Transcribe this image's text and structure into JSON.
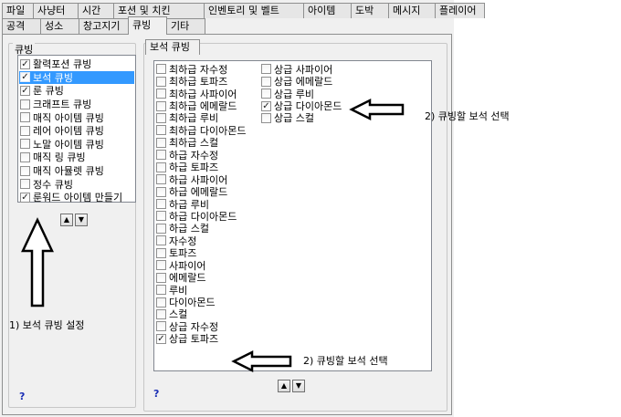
{
  "tabs_row1": [
    "파일",
    "사냥터",
    "시간",
    "포션 및 치킨",
    "인벤토리 및 벨트",
    "아이템",
    "도박",
    "메시지",
    "플레이어"
  ],
  "tabs_row2": [
    "공격",
    "성소",
    "창고지기",
    "큐빙",
    "기타"
  ],
  "active_tab": "큐빙",
  "left_panel": {
    "title": "큐빙",
    "items": [
      {
        "label": "활력포션 큐빙",
        "checked": true,
        "selected": false
      },
      {
        "label": "보석 큐빙",
        "checked": true,
        "selected": true
      },
      {
        "label": "룬 큐빙",
        "checked": true,
        "selected": false
      },
      {
        "label": "크래프트 큐빙",
        "checked": false,
        "selected": false
      },
      {
        "label": "매직 아이템 큐빙",
        "checked": false,
        "selected": false
      },
      {
        "label": "레어 아이템 큐빙",
        "checked": false,
        "selected": false
      },
      {
        "label": "노말 아이템 큐빙",
        "checked": false,
        "selected": false
      },
      {
        "label": "매직 링 큐빙",
        "checked": false,
        "selected": false
      },
      {
        "label": "매직 아뮬렛 큐빙",
        "checked": false,
        "selected": false
      },
      {
        "label": "정수 큐빙",
        "checked": false,
        "selected": false
      },
      {
        "label": "룬워드 아이템 만들기",
        "checked": true,
        "selected": false
      }
    ],
    "up_glyph": "▲",
    "down_glyph": "▼",
    "help": "?"
  },
  "right_panel": {
    "tab_label": "보석 큐빙",
    "column1": [
      {
        "label": "최하급 자수정",
        "checked": false
      },
      {
        "label": "최하급 토파즈",
        "checked": false
      },
      {
        "label": "최하급 사파이어",
        "checked": false
      },
      {
        "label": "최하급 에메랄드",
        "checked": false
      },
      {
        "label": "최하급 루비",
        "checked": false
      },
      {
        "label": "최하급 다이아몬드",
        "checked": false
      },
      {
        "label": "최하급 스컬",
        "checked": false
      },
      {
        "label": "하급 자수정",
        "checked": false
      },
      {
        "label": "하급 토파즈",
        "checked": false
      },
      {
        "label": "하급 사파이어",
        "checked": false
      },
      {
        "label": "하급 에메랄드",
        "checked": false
      },
      {
        "label": "하급 루비",
        "checked": false
      },
      {
        "label": "하급 다이아몬드",
        "checked": false
      },
      {
        "label": "하급 스컬",
        "checked": false
      },
      {
        "label": "자수정",
        "checked": false
      },
      {
        "label": "토파즈",
        "checked": false
      },
      {
        "label": "사파이어",
        "checked": false
      },
      {
        "label": "에메랄드",
        "checked": false
      },
      {
        "label": "루비",
        "checked": false
      },
      {
        "label": "다이아몬드",
        "checked": false
      },
      {
        "label": "스컬",
        "checked": false
      },
      {
        "label": "상급 자수정",
        "checked": false
      },
      {
        "label": "상급 토파즈",
        "checked": true
      }
    ],
    "column2": [
      {
        "label": "상급 사파이어",
        "checked": false
      },
      {
        "label": "상급 에메랄드",
        "checked": false
      },
      {
        "label": "상급 루비",
        "checked": false
      },
      {
        "label": "상급 다이아몬드",
        "checked": true
      },
      {
        "label": "상급 스컬",
        "checked": false
      }
    ],
    "up_glyph": "▲",
    "down_glyph": "▼",
    "help": "?"
  },
  "annotations": {
    "step1": "1) 보석 큐빙 설정",
    "step2_top": "2) 큐빙할 보석 선택",
    "step2_bottom": "2) 큐빙할 보석 선택"
  },
  "check_glyph": "✓"
}
